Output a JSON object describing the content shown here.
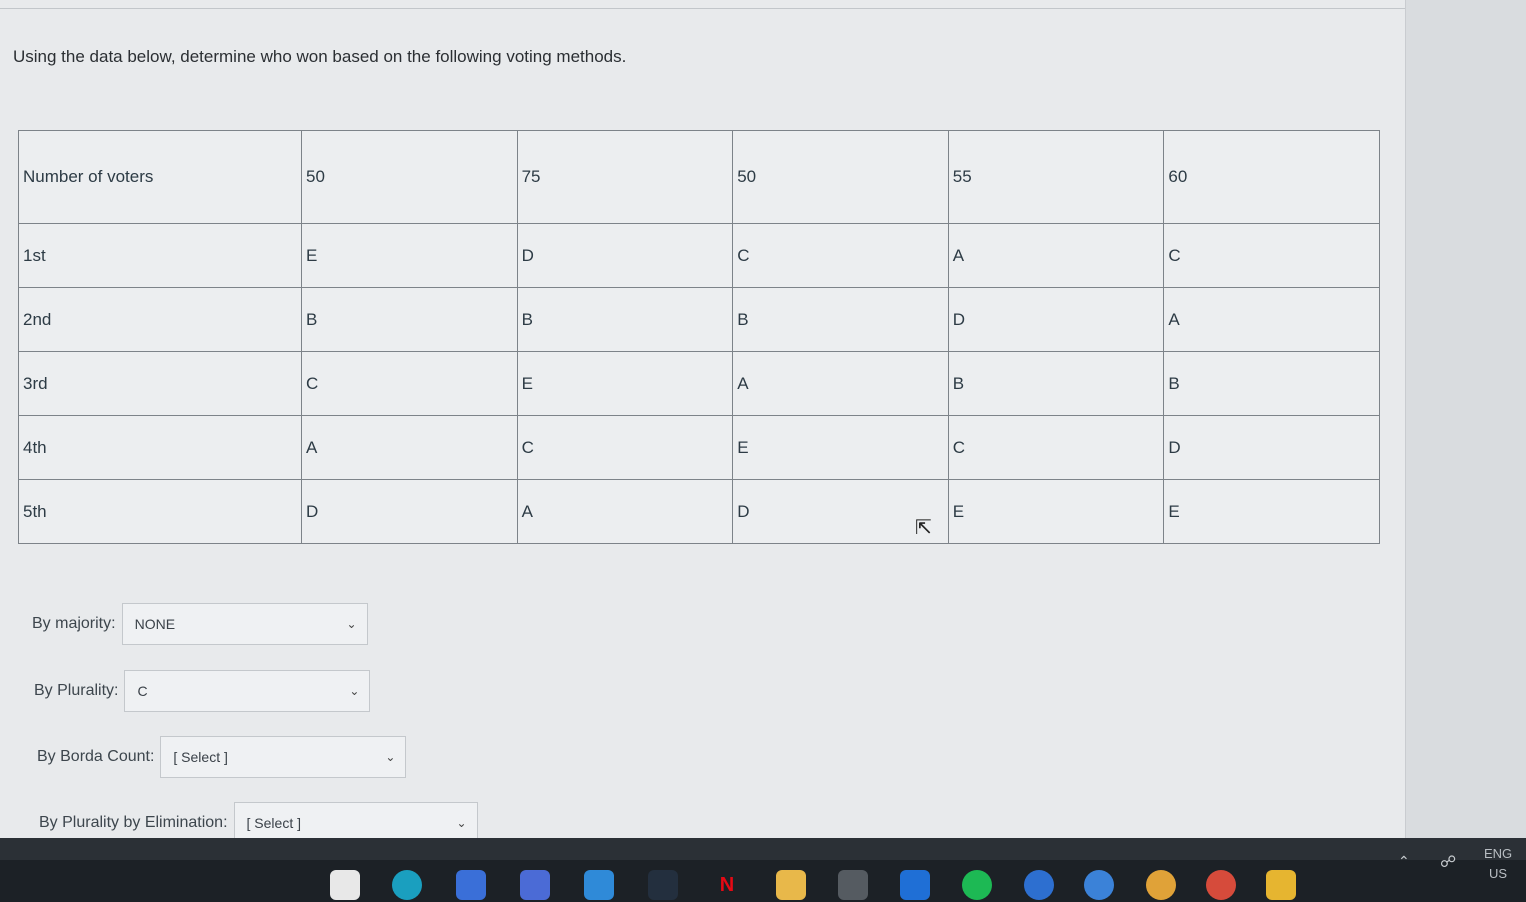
{
  "question": "Using the data below, determine who won based on the following voting methods.",
  "table": {
    "header": [
      "Number of voters",
      "50",
      "75",
      "50",
      "55",
      "60"
    ],
    "rows": [
      [
        "1st",
        "E",
        "D",
        "C",
        "A",
        "C"
      ],
      [
        "2nd",
        "B",
        "B",
        "B",
        "D",
        "A"
      ],
      [
        "3rd",
        "C",
        "E",
        "A",
        "B",
        "B"
      ],
      [
        "4th",
        "A",
        "C",
        "E",
        "C",
        "D"
      ],
      [
        "5th",
        "D",
        "A",
        "D",
        "E",
        "E"
      ]
    ]
  },
  "answers": [
    {
      "label": "By majority:",
      "value": "NONE"
    },
    {
      "label": "By Plurality:",
      "value": "C"
    },
    {
      "label": "By Borda Count:",
      "value": "[ Select ]"
    },
    {
      "label": "By Plurality by Elimination:",
      "value": "[ Select ]"
    }
  ],
  "taskbar": {
    "icons": [
      "file-explorer-icon",
      "edge-icon",
      "teams-icon",
      "microsoft-store-icon",
      "amazon-icon",
      "netflix-icon",
      "files-icon",
      "amazon-app-icon",
      "dropbox-icon",
      "spotify-icon",
      "play-icon",
      "chrome-icon",
      "chrome-canary-icon",
      "chrome-dev-icon",
      "sticky-notes-icon"
    ],
    "lang_line1": "ENG",
    "lang_line2": "US"
  }
}
